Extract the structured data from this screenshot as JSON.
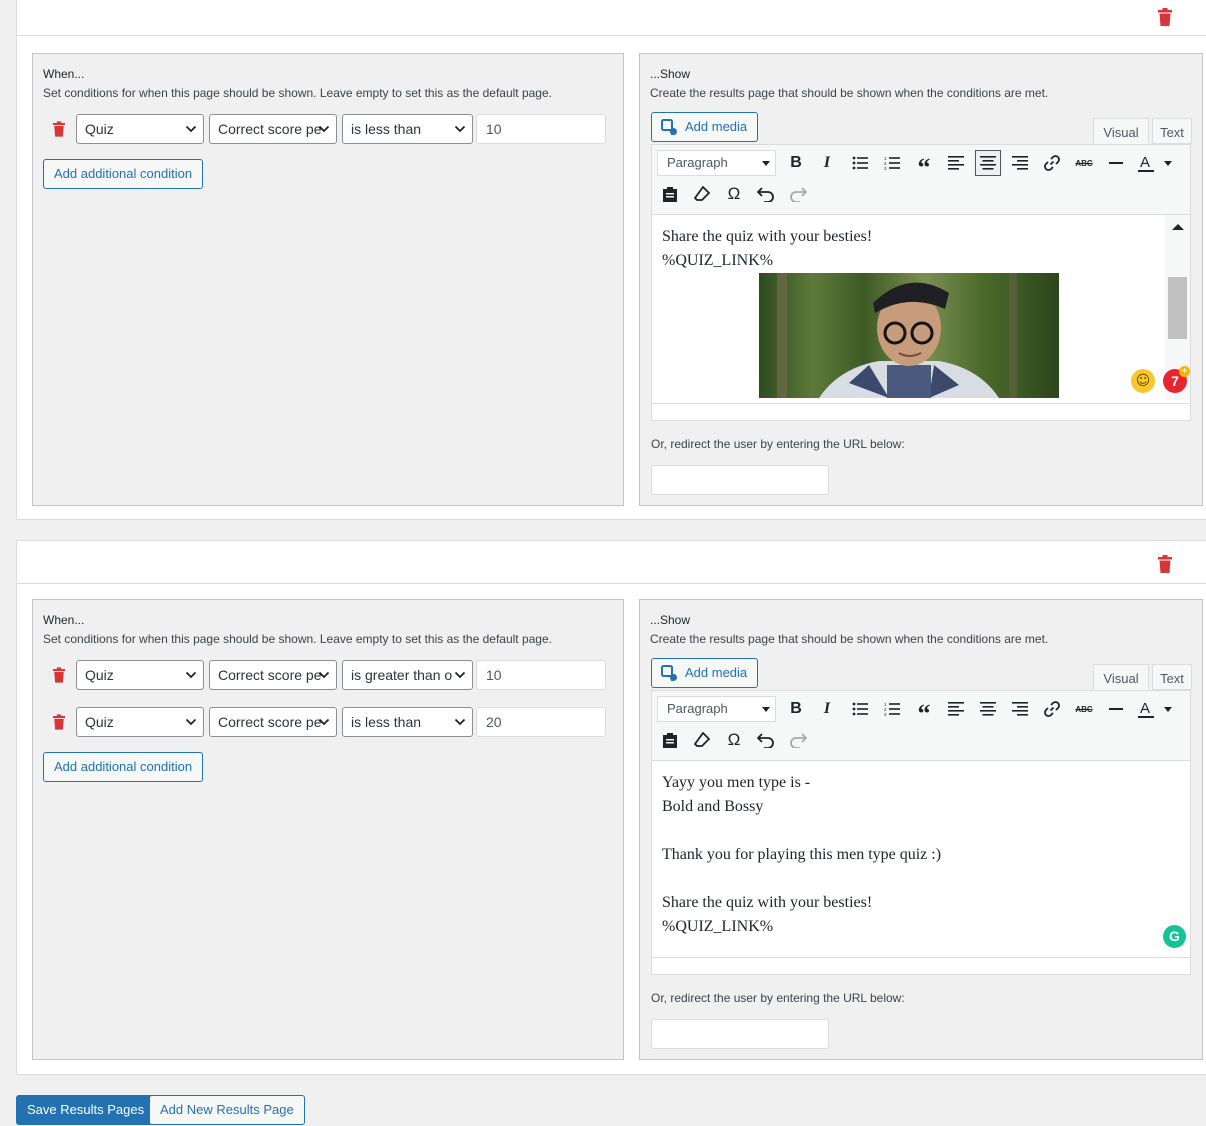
{
  "colors": {
    "accent": "#2271b1",
    "trash": "#d63638",
    "grammarly": "#15c39a",
    "badge": "#e6252f"
  },
  "pages": [
    {
      "when": {
        "title": "When...",
        "description": "Set conditions for when this page should be shown. Leave empty to set this as the default page.",
        "conditions": [
          {
            "source": "Quiz",
            "criteria": "Correct score pe",
            "operator": "is less than",
            "value": "10"
          }
        ],
        "add_condition_label": "Add additional condition"
      },
      "show": {
        "title": "...Show",
        "description": "Create the results page that should be shown when the conditions are met.",
        "add_media_label": "Add media",
        "tabs": {
          "visual": "Visual",
          "text": "Text"
        },
        "format_select": "Paragraph",
        "content_lines": [
          "Share the quiz with your besties!",
          "%QUIZ_LINK%"
        ],
        "badge_count": "7",
        "redirect_label": "Or, redirect the user by entering the URL below:",
        "redirect_value": ""
      }
    },
    {
      "when": {
        "title": "When...",
        "description": "Set conditions for when this page should be shown. Leave empty to set this as the default page.",
        "conditions": [
          {
            "source": "Quiz",
            "criteria": "Correct score pe",
            "operator": "is greater than o",
            "value": "10"
          },
          {
            "source": "Quiz",
            "criteria": "Correct score pe",
            "operator": "is less than",
            "value": "20"
          }
        ],
        "add_condition_label": "Add additional condition"
      },
      "show": {
        "title": "...Show",
        "description": "Create the results page that should be shown when the conditions are met.",
        "add_media_label": "Add media",
        "tabs": {
          "visual": "Visual",
          "text": "Text"
        },
        "format_select": "Paragraph",
        "content_lines": [
          "Yayy you men type is -",
          "Bold and Bossy",
          "",
          "Thank you for playing this men type quiz :)",
          "",
          "Share the quiz with your besties!",
          "%QUIZ_LINK%"
        ],
        "redirect_label": "Or, redirect the user by entering the URL below:",
        "redirect_value": ""
      }
    }
  ],
  "footer": {
    "save_label": "Save Results Pages",
    "add_new_label": "Add New Results Page"
  }
}
